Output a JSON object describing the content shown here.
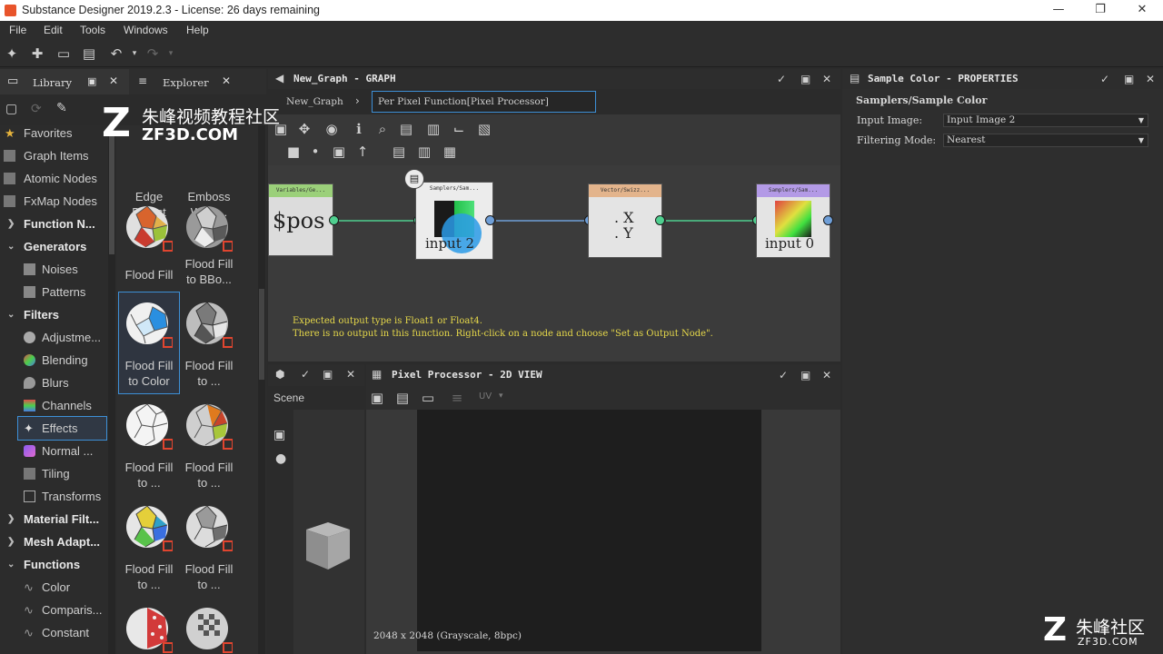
{
  "window": {
    "title": "Substance Designer 2019.2.3 - License: 26 days remaining"
  },
  "menu": [
    "File",
    "Edit",
    "Tools",
    "Windows",
    "Help"
  ],
  "library": {
    "tab_library": "Library",
    "tab_explorer": "Explorer",
    "tree": [
      {
        "label": "Favorites",
        "bold": false
      },
      {
        "label": "Graph Items",
        "bold": false
      },
      {
        "label": "Atomic Nodes",
        "bold": false
      },
      {
        "label": "FxMap Nodes",
        "bold": false
      },
      {
        "label": "Function N...",
        "bold": true
      },
      {
        "label": "Generators",
        "bold": true
      },
      {
        "label": "Noises",
        "bold": false
      },
      {
        "label": "Patterns",
        "bold": false
      },
      {
        "label": "Filters",
        "bold": true
      },
      {
        "label": "Adjustme...",
        "bold": false
      },
      {
        "label": "Blending",
        "bold": false
      },
      {
        "label": "Blurs",
        "bold": false
      },
      {
        "label": "Channels",
        "bold": false
      },
      {
        "label": "Effects",
        "bold": false
      },
      {
        "label": "Normal ...",
        "bold": false
      },
      {
        "label": "Tiling",
        "bold": false
      },
      {
        "label": "Transforms",
        "bold": false
      },
      {
        "label": "Material Filt...",
        "bold": true
      },
      {
        "label": "Mesh Adapt...",
        "bold": true
      },
      {
        "label": "Functions",
        "bold": true
      },
      {
        "label": "Color",
        "bold": false
      },
      {
        "label": "Comparis...",
        "bold": false
      },
      {
        "label": "Constant",
        "bold": false
      }
    ],
    "thumbs": [
      {
        "l1": "Edge",
        "l2": "Detect"
      },
      {
        "l1": "Emboss",
        "l2": "With ..."
      },
      {
        "l1": "Flood Fill",
        "l2": ""
      },
      {
        "l1": "Flood Fill",
        "l2": "to BBo..."
      },
      {
        "l1": "Flood Fill",
        "l2": "to Color"
      },
      {
        "l1": "Flood Fill",
        "l2": "to ..."
      },
      {
        "l1": "Flood Fill",
        "l2": "to ..."
      },
      {
        "l1": "Flood Fill",
        "l2": "to ..."
      },
      {
        "l1": "Flood Fill",
        "l2": "to ..."
      },
      {
        "l1": "Flood Fill",
        "l2": "to ..."
      }
    ]
  },
  "graph": {
    "title": "New_Graph - GRAPH",
    "breadcrumb_root": "New_Graph",
    "breadcrumb_current": "Per Pixel Function[Pixel Processor]",
    "nodes": {
      "pos": {
        "header": "Variables/Ge...",
        "value": "$pos",
        "header_color": "#9bd07a"
      },
      "sample": {
        "header": "Samplers/Sam...",
        "value": "input 2"
      },
      "swizzle": {
        "header": "Vector/Swizz...",
        "value1": ". X",
        "value2": ". Y",
        "header_color": "#e3b48c"
      },
      "sample2": {
        "header": "Samplers/Sam...",
        "value": "input 0",
        "header_color": "#b39ae6"
      }
    },
    "message_line1": "Expected output type is Float1 or Float4.",
    "message_line2": "There is no output in this function. Right-click on a node and choose \"Set as Output Node\"."
  },
  "properties": {
    "title": "Sample Color - PROPERTIES",
    "section": "Samplers/Sample Color",
    "input_image_label": "Input Image:",
    "input_image_value": "Input Image 2",
    "filtering_label": "Filtering Mode:",
    "filtering_value": "Nearest"
  },
  "scene": {
    "label": "Scene"
  },
  "view2d": {
    "title": "Pixel Processor - 2D VIEW",
    "uv_label": "UV",
    "status": "2048 x 2048 (Grayscale, 8bpc)"
  },
  "watermark": {
    "top_text": "朱峰视频教程社区",
    "top_url": "ZF3D.COM",
    "bottom_text": "朱峰社区",
    "bottom_url": "ZF3D.COM"
  },
  "colors": {
    "accent": "#3d8fd6",
    "pin_green": "#4fcf8f",
    "pin_blue": "#6f9fd8"
  }
}
